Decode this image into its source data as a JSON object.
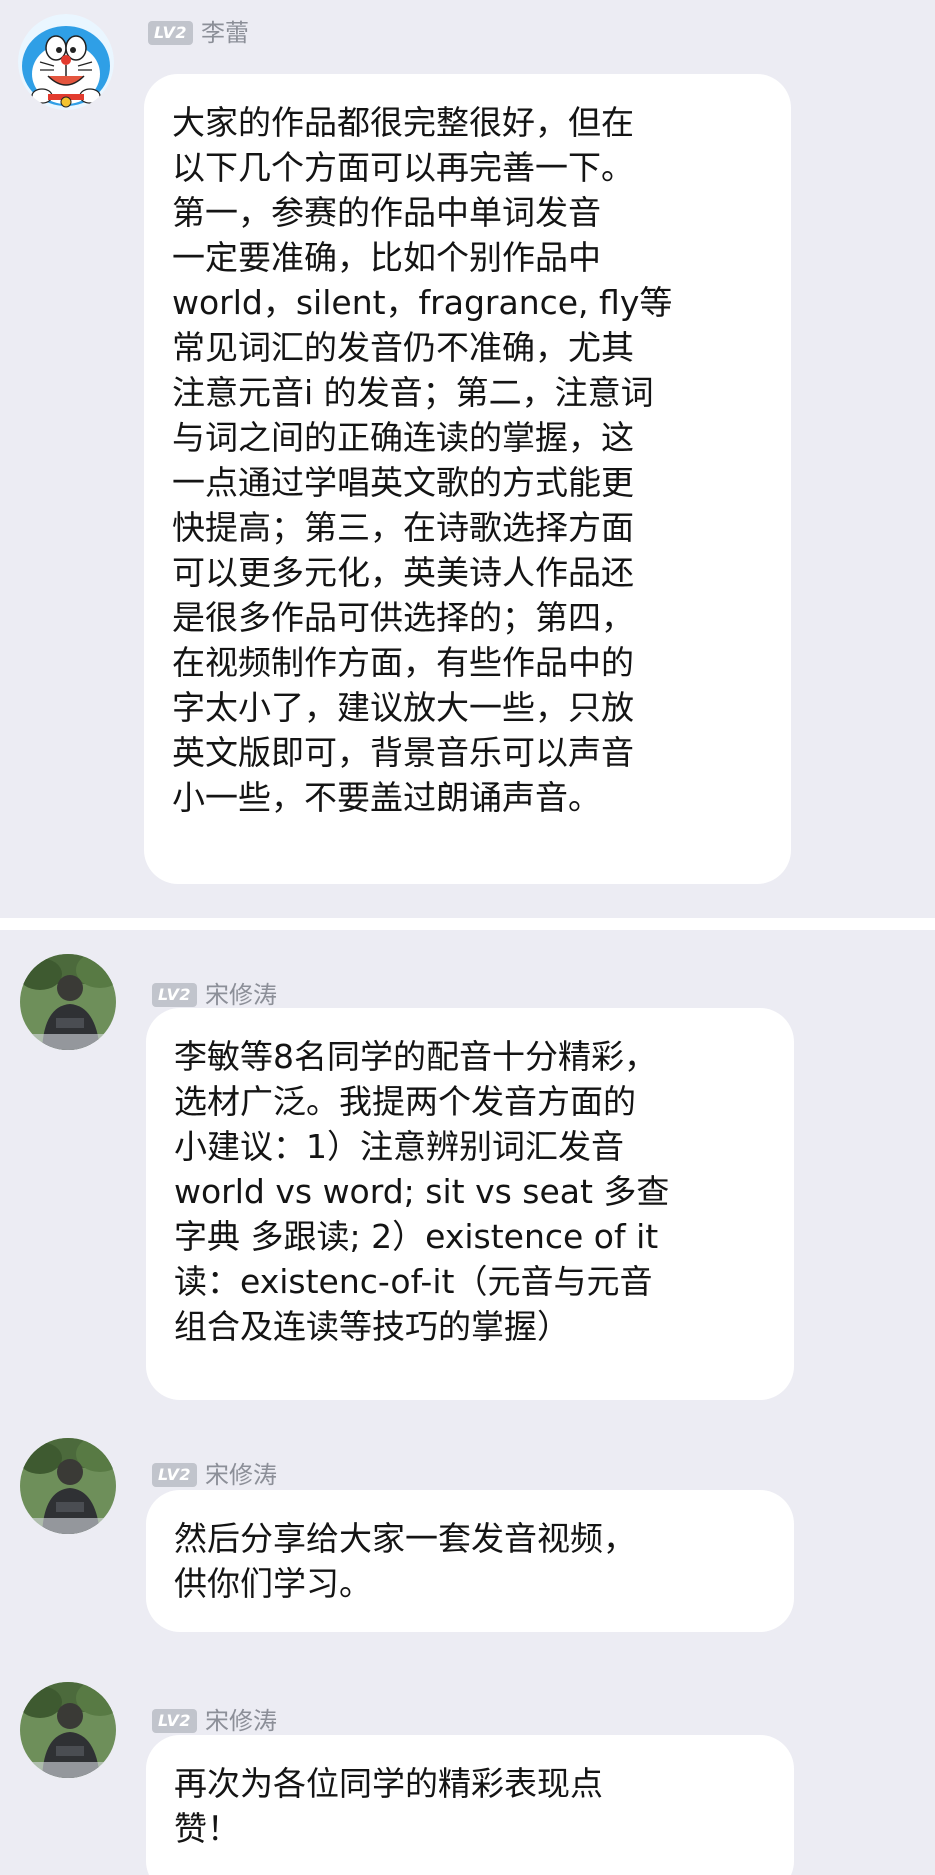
{
  "messages": [
    {
      "avatar": "doraemon-avatar",
      "level": "LV2",
      "sender": "李蕾",
      "lines": [
        "大家的作品都很完整很好，但在",
        "以下几个方面可以再完善一下。",
        "第一，参赛的作品中单词发音",
        "一定要准确，比如个别作品中",
        "world，silent，fragrance, fly等",
        "常见词汇的发音仍不准确，尤其",
        "注意元音i 的发音；第二，注意词",
        "与词之间的正确连读的掌握，这",
        "一点通过学唱英文歌的方式能更",
        "快提高；第三，在诗歌选择方面",
        "可以更多元化，英美诗人作品还",
        "是很多作品可供选择的；第四，",
        "在视频制作方面，有些作品中的",
        "字太小了，建议放大一些，只放",
        "英文版即可，背景音乐可以声音",
        "小一些，不要盖过朗诵声音。"
      ]
    },
    {
      "avatar": "person-photo-avatar",
      "level": "LV2",
      "sender": "宋修涛",
      "lines": [
        "李敏等8名同学的配音十分精彩，",
        "选材广泛。我提两个发音方面的",
        "小建议：1）注意辨别词汇发音",
        "world vs word; sit vs seat 多查",
        "字典 多跟读; 2）existence of it",
        "读：existenc-of-it（元音与元音",
        "组合及连读等技巧的掌握）"
      ]
    },
    {
      "avatar": "person-photo-avatar",
      "level": "LV2",
      "sender": "宋修涛",
      "lines": [
        "然后分享给大家一套发音视频，",
        "供你们学习。"
      ]
    },
    {
      "avatar": "person-photo-avatar",
      "level": "LV2",
      "sender": "宋修涛",
      "lines": [
        "再次为各位同学的精彩表现点",
        "赞！"
      ]
    }
  ]
}
